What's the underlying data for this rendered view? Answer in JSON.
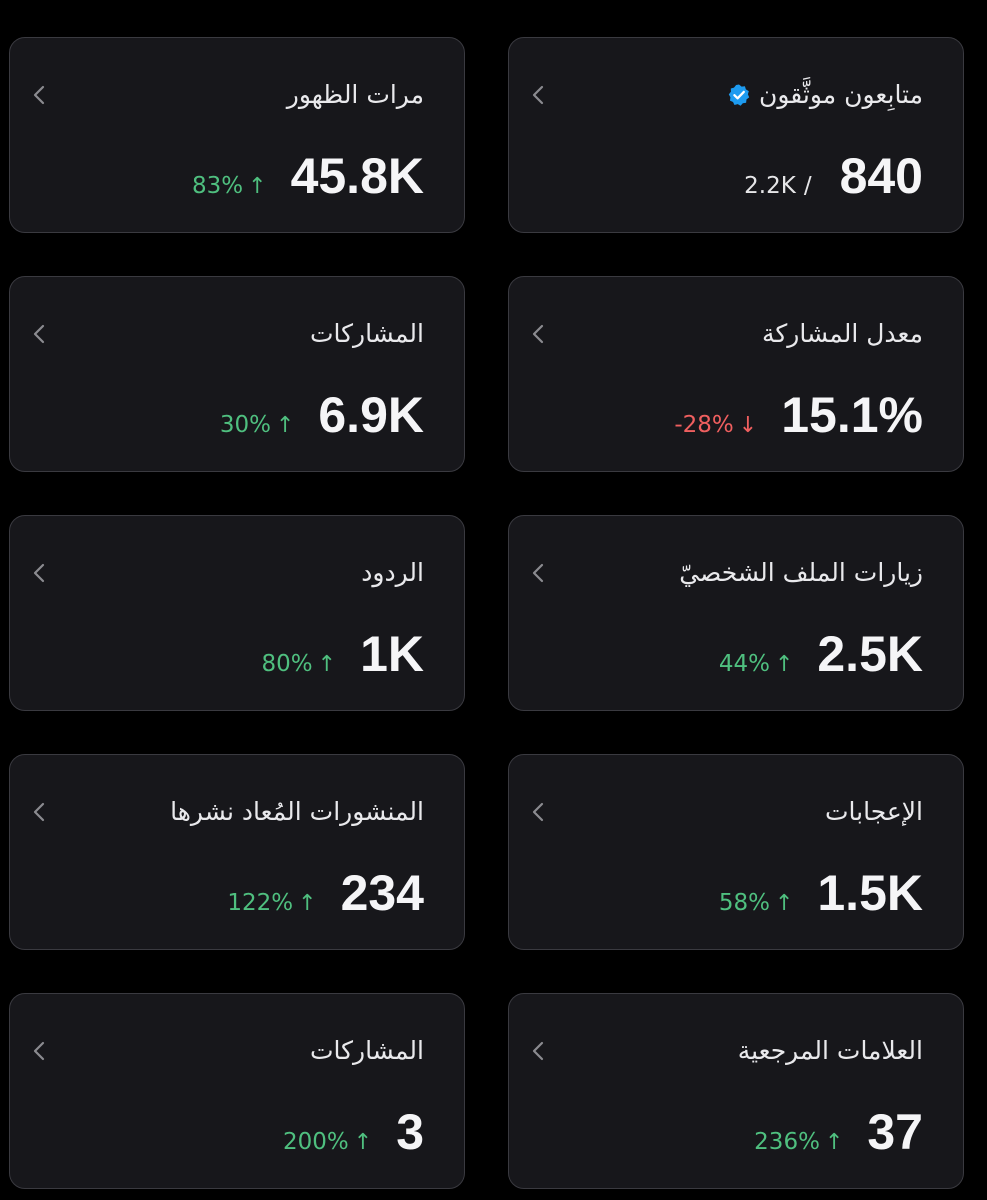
{
  "accent_colors": {
    "positive": "#4fbf7f",
    "negative": "#ef5f5f",
    "verified": "#1d9bf0"
  },
  "cards": [
    {
      "title": "متابِعون موثَّقون",
      "icon": "verified-badge-icon",
      "value": "840",
      "total": "2.2K",
      "separator": "/"
    },
    {
      "title": "مرات الظهور",
      "value": "45.8K",
      "change": "83%",
      "direction": "up",
      "arrow": "↑"
    },
    {
      "title": "معدل المشاركة",
      "value": "15.1%",
      "change": "-28%",
      "direction": "down",
      "arrow": "↓"
    },
    {
      "title": "المشاركات",
      "value": "6.9K",
      "change": "30%",
      "direction": "up",
      "arrow": "↑"
    },
    {
      "title": "زيارات الملف الشخصيّ",
      "value": "2.5K",
      "change": "44%",
      "direction": "up",
      "arrow": "↑"
    },
    {
      "title": "الردود",
      "value": "1K",
      "change": "80%",
      "direction": "up",
      "arrow": "↑"
    },
    {
      "title": "الإعجابات",
      "value": "1.5K",
      "change": "58%",
      "direction": "up",
      "arrow": "↑"
    },
    {
      "title": "المنشورات المُعاد نشرها",
      "value": "234",
      "change": "122%",
      "direction": "up",
      "arrow": "↑"
    },
    {
      "title": "العلامات المرجعية",
      "value": "37",
      "change": "236%",
      "direction": "up",
      "arrow": "↑"
    },
    {
      "title": "المشاركات",
      "value": "3",
      "change": "200%",
      "direction": "up",
      "arrow": "↑"
    }
  ]
}
